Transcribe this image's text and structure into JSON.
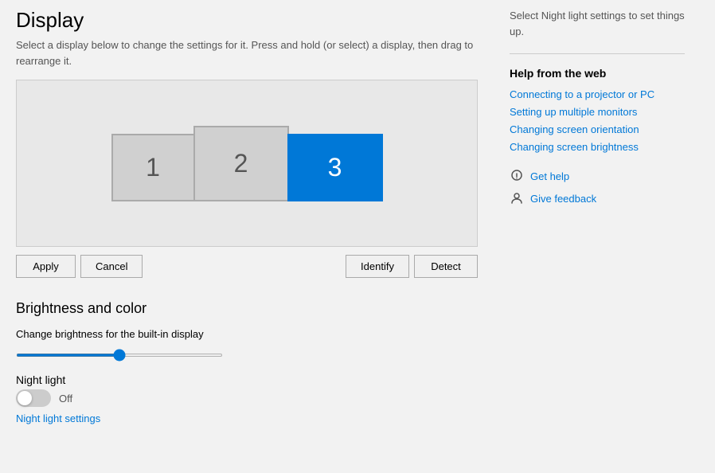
{
  "page": {
    "title": "Display",
    "subtitle": "Select a display below to change the settings for it. Press and hold (or select) a display, then drag to rearrange it."
  },
  "monitors": [
    {
      "id": 1,
      "label": "1",
      "active": false
    },
    {
      "id": 2,
      "label": "2",
      "active": false
    },
    {
      "id": 3,
      "label": "3",
      "active": true
    }
  ],
  "buttons": {
    "apply": "Apply",
    "cancel": "Cancel",
    "identify": "Identify",
    "detect": "Detect"
  },
  "brightness": {
    "section_title": "Brightness and color",
    "label": "Change brightness for the built-in display",
    "value": 50
  },
  "night_light": {
    "label": "Night light",
    "status": "Off",
    "settings_link": "Night light settings"
  },
  "right_panel": {
    "subtitle": "Select Night light settings to set things up.",
    "help_web_title": "Help from the web",
    "links": [
      {
        "text": "Connecting to a projector or PC"
      },
      {
        "text": "Setting up multiple monitors"
      },
      {
        "text": "Changing screen orientation"
      },
      {
        "text": "Changing screen brightness"
      }
    ],
    "get_help_label": "Get help",
    "give_feedback_label": "Give feedback"
  }
}
